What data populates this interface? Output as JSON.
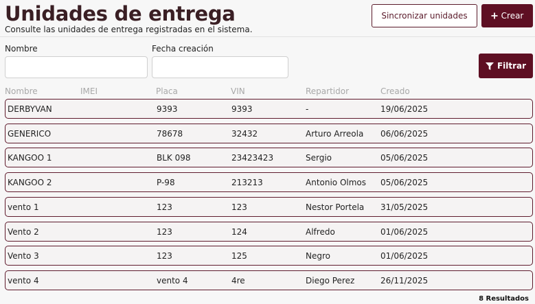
{
  "header": {
    "title": "Unidades de entrega",
    "subtitle": "Consulte las unidades de entrega registradas en el sistema.",
    "sync_label": "Sincronizar unidades",
    "create_label": "Crear"
  },
  "filters": {
    "name_label": "Nombre",
    "name_value": "",
    "date_label": "Fecha creación",
    "date_value": "",
    "filter_label": "Filtrar"
  },
  "table": {
    "columns": [
      "Nombre",
      "IMEI",
      "Placa",
      "VIN",
      "Repartidor",
      "Creado"
    ],
    "rows": [
      {
        "nombre": "DERBYVAN",
        "imei": "",
        "placa": "9393",
        "vin": "9393",
        "repartidor": "-",
        "creado": "19/06/2025"
      },
      {
        "nombre": "GENERICO",
        "imei": "",
        "placa": "78678",
        "vin": "32432",
        "repartidor": "Arturo Arreola",
        "creado": "06/06/2025"
      },
      {
        "nombre": "KANGOO 1",
        "imei": "",
        "placa": "BLK 098",
        "vin": "23423423",
        "repartidor": "Sergio",
        "creado": "05/06/2025"
      },
      {
        "nombre": "KANGOO 2",
        "imei": "",
        "placa": "P-98",
        "vin": "213213",
        "repartidor": "Antonio Olmos",
        "creado": "05/06/2025"
      },
      {
        "nombre": "vento 1",
        "imei": "",
        "placa": "123",
        "vin": "123",
        "repartidor": "Nestor Portela",
        "creado": "31/05/2025"
      },
      {
        "nombre": "Vento 2",
        "imei": "",
        "placa": "123",
        "vin": "124",
        "repartidor": "Alfredo",
        "creado": "01/06/2025"
      },
      {
        "nombre": "Vento 3",
        "imei": "",
        "placa": "123",
        "vin": "125",
        "repartidor": "Negro",
        "creado": "01/06/2025"
      },
      {
        "nombre": "vento 4",
        "imei": "",
        "placa": "vento 4",
        "vin": "4re",
        "repartidor": "Diego Perez",
        "creado": "26/11/2025"
      }
    ]
  },
  "footer": {
    "results_label": "8 Resultados"
  },
  "icons": {
    "create": "plus-icon",
    "filter": "funnel-icon"
  },
  "colors": {
    "primary": "#5e0f23",
    "title": "#3a1f24"
  }
}
